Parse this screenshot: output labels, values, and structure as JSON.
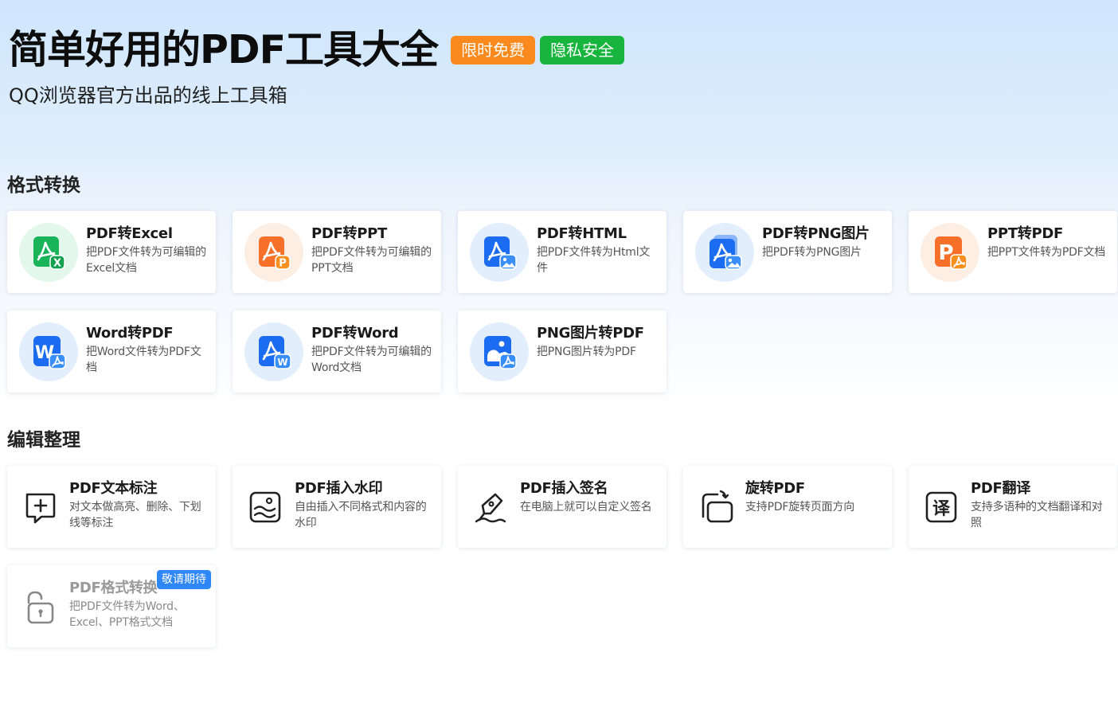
{
  "hero": {
    "title": "简单好用的PDF工具大全",
    "badge_free": "限时免费",
    "badge_safe": "隐私安全",
    "subtitle": "QQ浏览器官方出品的线上工具箱"
  },
  "colors": {
    "badge_free": "#fa8a1e",
    "badge_safe": "#18b53e",
    "coming_soon": "#2f86f6"
  },
  "sections": {
    "convert": {
      "title": "格式转换",
      "items": [
        {
          "title": "PDF转Excel",
          "desc": "把PDF文件转为可编辑的Excel文档",
          "icon": "pdf-to-excel-icon"
        },
        {
          "title": "PDF转PPT",
          "desc": "把PDF文件转为可编辑的PPT文档",
          "icon": "pdf-to-ppt-icon"
        },
        {
          "title": "PDF转HTML",
          "desc": "把PDF文件转为Html文件",
          "icon": "pdf-to-html-icon"
        },
        {
          "title": "PDF转PNG图片",
          "desc": "把PDF转为PNG图片",
          "icon": "pdf-to-png-icon"
        },
        {
          "title": "PPT转PDF",
          "desc": "把PPT文件转为PDF文档",
          "icon": "ppt-to-pdf-icon"
        },
        {
          "title": "Word转PDF",
          "desc": "把Word文件转为PDF文档",
          "icon": "word-to-pdf-icon"
        },
        {
          "title": "PDF转Word",
          "desc": "把PDF文件转为可编辑的Word文档",
          "icon": "pdf-to-word-icon"
        },
        {
          "title": "PNG图片转PDF",
          "desc": "把PNG图片转为PDF",
          "icon": "png-to-pdf-icon"
        }
      ]
    },
    "edit": {
      "title": "编辑整理",
      "items": [
        {
          "title": "PDF文本标注",
          "desc": "对文本做高亮、删除、下划线等标注",
          "icon": "annotate-icon"
        },
        {
          "title": "PDF插入水印",
          "desc": "自由插入不同格式和内容的水印",
          "icon": "watermark-icon"
        },
        {
          "title": "PDF插入签名",
          "desc": "在电脑上就可以自定义签名",
          "icon": "signature-icon"
        },
        {
          "title": "旋转PDF",
          "desc": "支持PDF旋转页面方向",
          "icon": "rotate-icon"
        },
        {
          "title": "PDF翻译",
          "desc": "支持多语种的文档翻译和对照",
          "icon": "translate-icon"
        },
        {
          "title": "PDF格式转换",
          "desc": "把PDF文件转为Word、Excel、PPT格式文档",
          "icon": "unlock-icon",
          "badge": "敬请期待"
        }
      ]
    }
  }
}
